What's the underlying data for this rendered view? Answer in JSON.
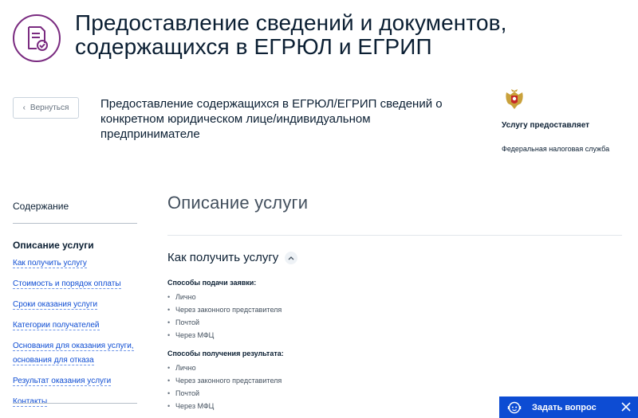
{
  "header": {
    "title": "Предоставление сведений и документов, содержащихся в ЕГРЮЛ и ЕГРИП"
  },
  "back_button": {
    "label": "Вернуться"
  },
  "service": {
    "name": "Предоставление содержащихся в ЕГРЮЛ/ЕГРИП сведений о конкретном юридическом лице/индивидуальном предпринимателе"
  },
  "provider": {
    "label": "Услугу предоставляет",
    "name": "Федеральная налоговая служба"
  },
  "sidebar": {
    "title": "Содержание",
    "active": "Описание услуги",
    "links": [
      "Как получить услугу",
      "Стоимость и порядок оплаты",
      "Сроки оказания услуги",
      "Категории получателей",
      "Основания для оказания услуги, основания для отказа",
      "Результат оказания услуги",
      "Контакты"
    ]
  },
  "main": {
    "section_title": "Описание услуги",
    "sub_title": "Как получить услугу",
    "submit_title": "Способы подачи заявки:",
    "submit_methods": [
      "Лично",
      "Через законного представителя",
      "Почтой",
      "Через МФЦ"
    ],
    "result_title": "Способы получения результата:",
    "result_methods": [
      "Лично",
      "Через законного представителя",
      "Почтой",
      "Через МФЦ"
    ]
  },
  "widget": {
    "label": "Задать вопрос"
  },
  "colors": {
    "accent": "#0d4cd3",
    "icon_purple": "#7a2b80",
    "text": "#0b1f33"
  }
}
